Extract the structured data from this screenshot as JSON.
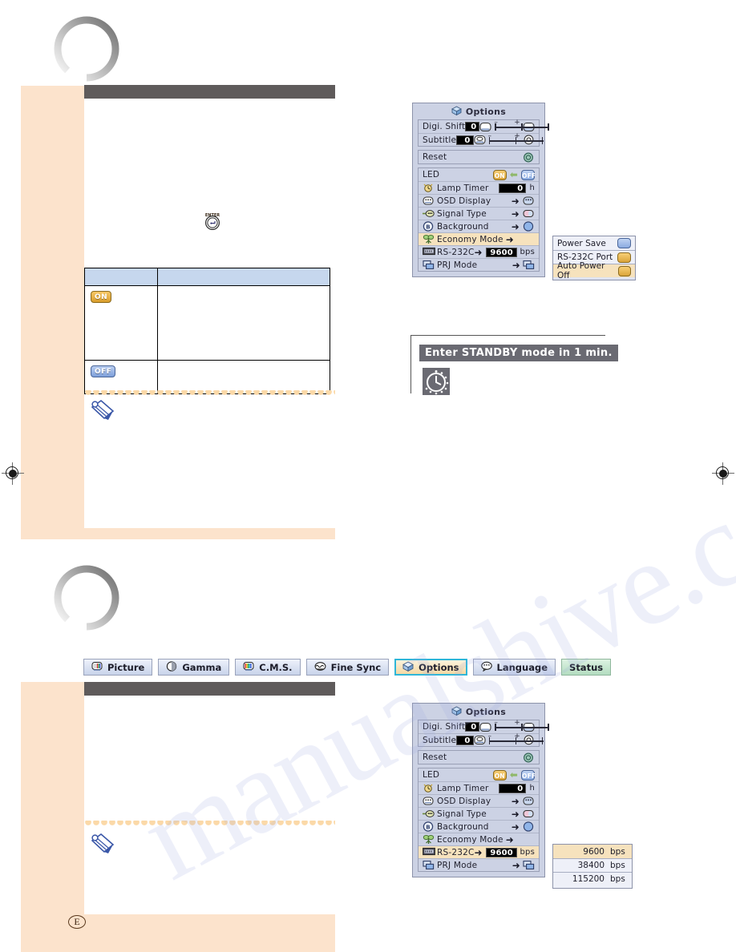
{
  "page": {
    "page_letter": "E",
    "watermark": "manualshive.com",
    "bg_color": "#fce3cc",
    "header_bar_color": "#5f5b5b",
    "accent_highlight": "#f6e2bd",
    "tab_selected_border": "#2fb6d8"
  },
  "section_one": {
    "table": {
      "headers": [
        "",
        ""
      ],
      "rows": [
        {
          "badge": "ON",
          "badge_state": "on",
          "description": ""
        },
        {
          "badge": "OFF",
          "badge_state": "off",
          "description": ""
        }
      ]
    },
    "note_icon": "pencil-note-icon",
    "info_button_icon": "enter-button-icon"
  },
  "osd_top": {
    "title": "Options",
    "title_icon": "options-cube-icon",
    "group_a": [
      {
        "label": "Digi. Shift",
        "value": "0",
        "left_icon": "shift-up-icon",
        "right_icon": "shift-down-icon",
        "slider": true
      },
      {
        "label": "Subtitle",
        "value": "0",
        "left_icon": "subtitle-icon",
        "right_icon": "subtitle-target-icon",
        "slider": true
      }
    ],
    "group_b": [
      {
        "label": "Reset",
        "right_icon": "reset-icon"
      }
    ],
    "group_c": [
      {
        "label": "LED",
        "type": "toggle",
        "on_label": "ON",
        "off_label": "OFF",
        "selected": "ON"
      },
      {
        "label": "Lamp Timer",
        "left_icon": "lamp-timer-icon",
        "value": "0",
        "unit": "h"
      },
      {
        "label": "OSD Display",
        "left_icon": "osd-display-icon",
        "arrow": "➜",
        "right_icon": "osd-display-icon"
      },
      {
        "label": "Signal Type",
        "left_icon": "signal-type-icon",
        "arrow": "➜",
        "right_icon": "signal-type-icon"
      },
      {
        "label": "Background",
        "left_icon": "background-icon",
        "arrow": "➜",
        "right_icon": "background-blue-icon"
      },
      {
        "label": "Economy Mode",
        "left_icon": "economy-tree-icon",
        "arrow": "➜",
        "highlighted": true
      },
      {
        "label": "RS-232C",
        "left_icon": "rs232c-icon",
        "arrow": "➜",
        "value": "9600",
        "unit": "bps"
      },
      {
        "label": "PRJ Mode",
        "left_icon": "prj-mode-icon",
        "arrow": "➜",
        "right_icon": "prj-mode-icon"
      }
    ]
  },
  "economy_popup": {
    "items": [
      {
        "label": "Power Save",
        "state": "off",
        "highlighted": false
      },
      {
        "label": "RS-232C Port",
        "state": "on",
        "highlighted": false
      },
      {
        "label": "Auto Power Off",
        "state": "on",
        "highlighted": true
      }
    ]
  },
  "standby": {
    "message": "Enter STANDBY mode in 1 min.",
    "icon": "countdown-clock-icon"
  },
  "tabbar": {
    "tabs": [
      {
        "label": "Picture",
        "icon": "picture-icon",
        "selected": false,
        "style": "normal"
      },
      {
        "label": "Gamma",
        "icon": "gamma-icon",
        "selected": false,
        "style": "normal"
      },
      {
        "label": "C.M.S.",
        "icon": "cms-icon",
        "selected": false,
        "style": "normal"
      },
      {
        "label": "Fine Sync",
        "icon": "fine-sync-icon",
        "selected": false,
        "style": "normal"
      },
      {
        "label": "Options",
        "icon": "options-cube-icon",
        "selected": true,
        "style": "normal"
      },
      {
        "label": "Language",
        "icon": "language-icon",
        "selected": false,
        "style": "normal"
      },
      {
        "label": "Status",
        "icon": "",
        "selected": false,
        "style": "status"
      }
    ]
  },
  "osd_bottom": {
    "title": "Options",
    "title_icon": "options-cube-icon",
    "group_a": [
      {
        "label": "Digi. Shift",
        "value": "0"
      },
      {
        "label": "Subtitle",
        "value": "0"
      }
    ],
    "group_b": [
      {
        "label": "Reset"
      }
    ],
    "group_c": [
      {
        "label": "LED",
        "type": "toggle",
        "on_label": "ON",
        "off_label": "OFF",
        "selected": "ON"
      },
      {
        "label": "Lamp Timer",
        "value": "0",
        "unit": "h"
      },
      {
        "label": "OSD Display",
        "arrow": "➜"
      },
      {
        "label": "Signal Type",
        "arrow": "➜"
      },
      {
        "label": "Background",
        "arrow": "➜"
      },
      {
        "label": "Economy Mode",
        "arrow": "➜"
      },
      {
        "label": "RS-232C",
        "arrow": "➜",
        "value": "9600",
        "unit": "bps",
        "highlighted": true
      },
      {
        "label": "PRJ Mode",
        "arrow": "➜"
      }
    ]
  },
  "baud_popup": {
    "unit": "bps",
    "items": [
      {
        "value": "9600",
        "highlighted": true
      },
      {
        "value": "38400",
        "highlighted": false
      },
      {
        "value": "115200",
        "highlighted": false
      }
    ]
  }
}
